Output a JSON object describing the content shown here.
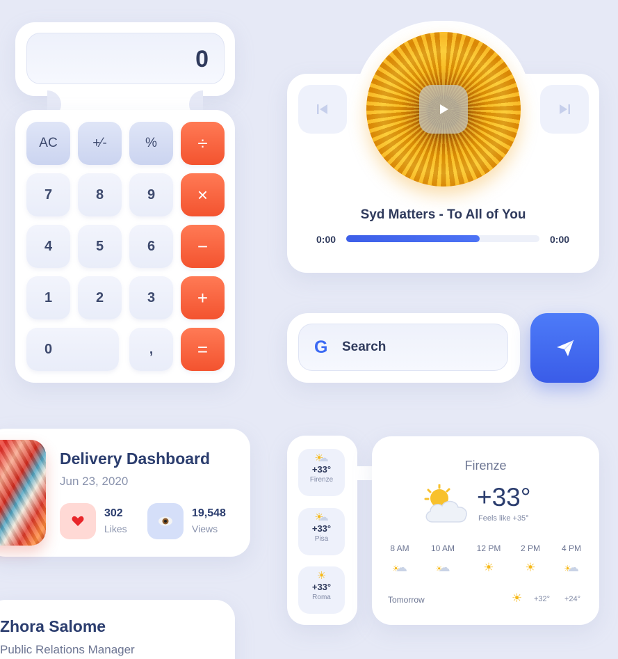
{
  "calculator": {
    "display_value": "0",
    "keys": {
      "ac": "AC",
      "plus_minus": "+⁄-",
      "percent": "%",
      "divide": "÷",
      "seven": "7",
      "eight": "8",
      "nine": "9",
      "multiply": "×",
      "four": "4",
      "five": "5",
      "six": "6",
      "minus": "−",
      "one": "1",
      "two": "2",
      "three": "3",
      "plus": "+",
      "zero": "0",
      "comma": ",",
      "equals": "="
    },
    "operator_color": "#f3532f"
  },
  "player": {
    "song_title": "Syd Matters - To All of You",
    "time_current": "0:00",
    "time_total": "0:00",
    "progress_fraction": 0.69,
    "accent_color": "#3d5fe8"
  },
  "search": {
    "logo_letter": "G",
    "placeholder": "Search",
    "send_icon": "paper-plane-icon"
  },
  "delivery": {
    "title": "Delivery Dashboard",
    "date": "Jun 23, 2020",
    "likes_value": "302",
    "likes_label": "Likes",
    "views_value": "19,548",
    "views_label": "Views"
  },
  "profile": {
    "name": "Zhora Salome",
    "role": "Public Relations Manager"
  },
  "weather": {
    "cities": [
      {
        "temp": "+33°",
        "name": "Firenze",
        "icon": "partly-cloudy-icon"
      },
      {
        "temp": "+33°",
        "name": "Pisa",
        "icon": "partly-cloudy-icon"
      },
      {
        "temp": "+33°",
        "name": "Roma",
        "icon": "sun-icon"
      }
    ],
    "current_city": "Firenze",
    "current_temp": "+33°",
    "feels_like": "Feels like +35°",
    "hourly": [
      {
        "time": "8 AM",
        "icon": "rain-cloud-icon"
      },
      {
        "time": "10 AM",
        "icon": "cloud-icon"
      },
      {
        "time": "12 PM",
        "icon": "sun-icon"
      },
      {
        "time": "2 PM",
        "icon": "sun-icon"
      },
      {
        "time": "4 PM",
        "icon": "rain-cloud-icon"
      }
    ],
    "tomorrow_label": "Tomorrow",
    "tomorrow_high": "+32°",
    "tomorrow_low": "+24°"
  }
}
